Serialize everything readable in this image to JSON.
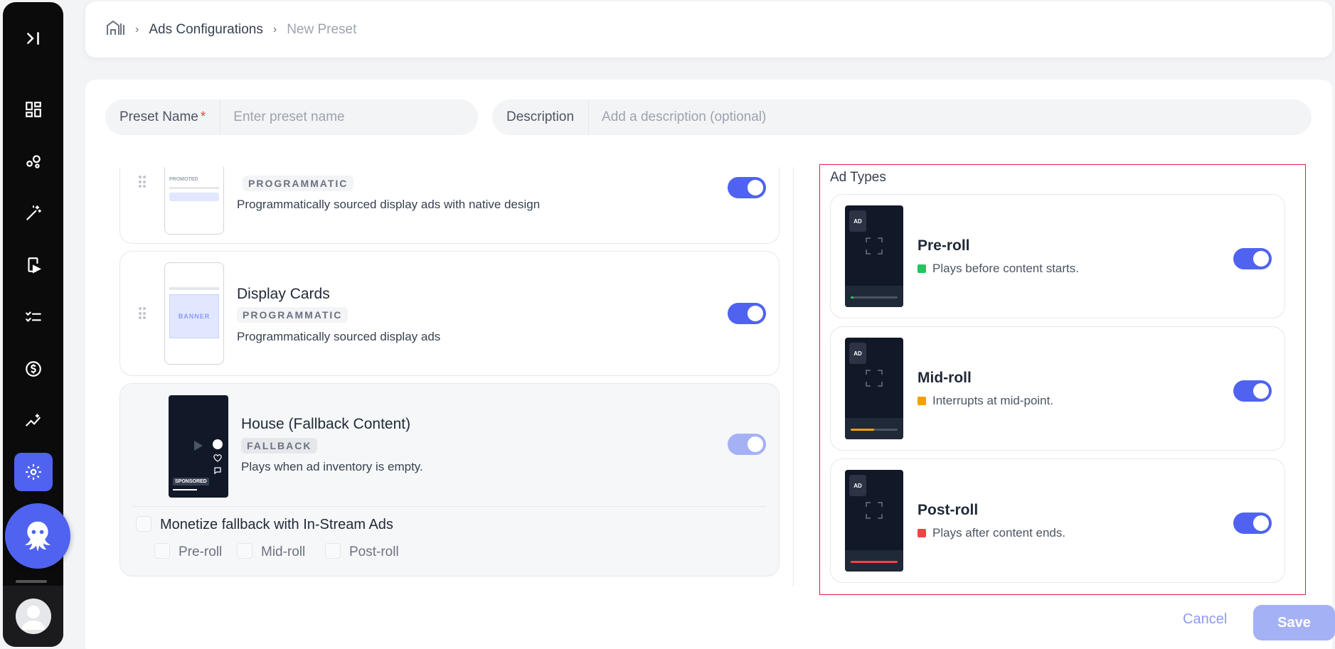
{
  "breadcrumb": {
    "parent": "Ads Configurations",
    "current": "New Preset"
  },
  "form": {
    "preset_name_label": "Preset Name",
    "preset_name_required": "*",
    "preset_name_placeholder": "Enter preset name",
    "description_label": "Description",
    "description_placeholder": "Add a description (optional)"
  },
  "placements": [
    {
      "title": "",
      "badge": "PROGRAMMATIC",
      "desc": "Programmatically sourced display ads with native design",
      "thumb_text": "PROMOTED",
      "enabled": true
    },
    {
      "title": "Display Cards",
      "badge": "PROGRAMMATIC",
      "desc": "Programmatically sourced display ads",
      "thumb_text": "BANNER",
      "enabled": true
    },
    {
      "title": "House (Fallback Content)",
      "badge": "FALLBACK",
      "desc": "Plays when ad inventory is empty.",
      "thumb_text": "SPONSORED",
      "enabled": true,
      "disabled": true
    }
  ],
  "fallback": {
    "monetize_label": "Monetize fallback with In-Stream Ads",
    "options": [
      "Pre-roll",
      "Mid-roll",
      "Post-roll"
    ]
  },
  "ad_types": {
    "title": "Ad Types",
    "thumb_tag": "AD",
    "items": [
      {
        "name": "Pre-roll",
        "desc": "Plays before content starts.",
        "color": "#22c55e",
        "progress": 0.05,
        "enabled": true
      },
      {
        "name": "Mid-roll",
        "desc": "Interrupts at mid-point.",
        "color": "#f59e0b",
        "progress": 0.5,
        "enabled": true
      },
      {
        "name": "Post-roll",
        "desc": "Plays after content ends.",
        "color": "#ef4444",
        "progress": 1.0,
        "enabled": true
      }
    ]
  },
  "actions": {
    "cancel": "Cancel",
    "save": "Save"
  },
  "colors": {
    "accent": "#4f63f0",
    "accent_disabled": "#a5b1f5",
    "highlight_border": "#e11d48"
  }
}
